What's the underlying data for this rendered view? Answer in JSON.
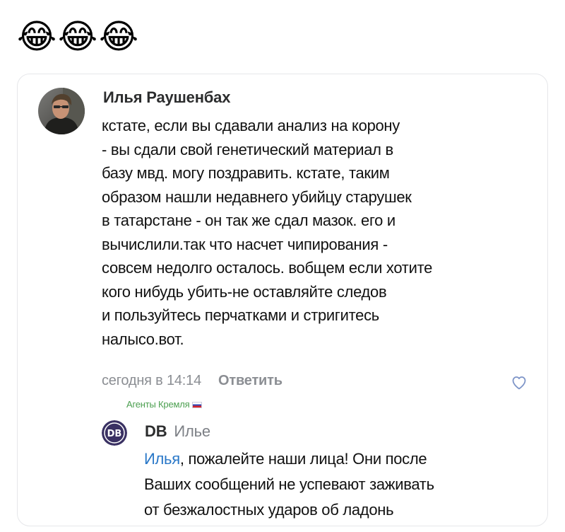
{
  "header": {
    "emojis": [
      "😂",
      "😂",
      "😂"
    ]
  },
  "comment": {
    "author": "Илья Раушенбах",
    "text": "кстате, если вы сдавали анализ на корону\n- вы сдали свой генетический материал в\nбазу мвд. могу поздравить. кстате, таким\nобразом нашли недавнего убийцу старушек\nв татарстане - он так же сдал мазок. его и\nвычислили.так что насчет чипирования -\nсовсем недолго осталось. вобщем если хотите\nкого нибудь убить-не оставляйте следов\nи пользуйтесь перчатками и стригитесь\nналысо.вот.",
    "timestamp": "сегодня в 14:14",
    "reply_label": "Ответить",
    "like_icon": "heart-outline-icon"
  },
  "group_label": "Агенты Кремля",
  "reply": {
    "avatar_text": "DB",
    "author": "DB",
    "to": "Илье",
    "mention": "Илья",
    "text": ", пожалейте наши лица! Они после\nВаших сообщений не успевают заживать\nот безжалостных ударов об ладонь"
  },
  "colors": {
    "mention": "#2a78c8",
    "meta": "#8b8e93",
    "group_label": "#4b9f4f"
  }
}
